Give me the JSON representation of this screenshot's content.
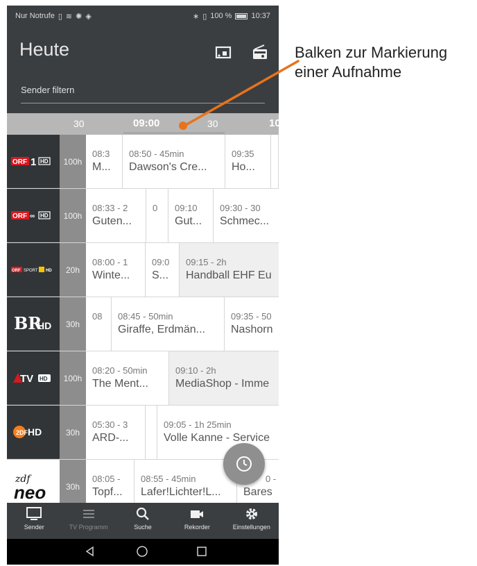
{
  "status_bar": {
    "left_text": "Nur Notrufe",
    "battery": "100 %",
    "time": "10:37"
  },
  "app_bar": {
    "title": "Heute",
    "icons": [
      "cast-icon",
      "radio-icon"
    ]
  },
  "filter": {
    "placeholder": "Sender filtern"
  },
  "timeline": {
    "labels": [
      "30",
      "09:00",
      "30",
      "10"
    ]
  },
  "channels": [
    {
      "logo": "ORF 1 HD",
      "duration": "100h",
      "programs": [
        {
          "time": "08:3",
          "title": "M..."
        },
        {
          "time": "08:50 - 45min",
          "title": "Dawson's Cre..."
        },
        {
          "time": "09:35",
          "title": "Ho..."
        },
        {
          "time": "·",
          "title": ""
        }
      ]
    },
    {
      "logo": "ORF III HD",
      "duration": "100h",
      "programs": [
        {
          "time": "08:33 - 2",
          "title": "Guten..."
        },
        {
          "time": "0",
          "title": ""
        },
        {
          "time": "09:10",
          "title": "Gut..."
        },
        {
          "time": "09:30 - 30",
          "title": "Schmec..."
        }
      ]
    },
    {
      "logo": "ORF SPORT+ HD",
      "duration": "20h",
      "programs": [
        {
          "time": "08:00 - 1",
          "title": "Winte..."
        },
        {
          "time": "09:0",
          "title": "S..."
        },
        {
          "time": "09:15 - 2h",
          "title": "Handball EHF Eu"
        }
      ]
    },
    {
      "logo": "BR HD",
      "duration": "30h",
      "programs": [
        {
          "time": "08",
          "title": ""
        },
        {
          "time": "08:45 - 50min",
          "title": "Giraffe, Erdmän..."
        },
        {
          "time": "09:35 - 50",
          "title": "Nashorn"
        }
      ]
    },
    {
      "logo": "ATV HD",
      "duration": "100h",
      "programs": [
        {
          "time": "08:20 - 50min",
          "title": "The Ment..."
        },
        {
          "time": "09:10 - 2h",
          "title": "MediaShop - Imme"
        }
      ]
    },
    {
      "logo": "ZDF HD",
      "duration": "30h",
      "programs": [
        {
          "time": "05:30 - 3",
          "title": "ARD-..."
        },
        {
          "time": "",
          "title": ""
        },
        {
          "time": "09:05 - 1h 25min",
          "title": "Volle Kanne - Service"
        }
      ]
    },
    {
      "logo": "zdf neo",
      "duration": "30h",
      "programs": [
        {
          "time": "08:05 -",
          "title": "Topf..."
        },
        {
          "time": "08:55 - 45min",
          "title": "Lafer!Lichter!L..."
        },
        {
          "time": "0 -",
          "title": "Bares"
        }
      ]
    }
  ],
  "bottom_nav": [
    {
      "label": "Sender",
      "icon": "tv-icon"
    },
    {
      "label": "TV Programm",
      "icon": "list-icon"
    },
    {
      "label": "Suche",
      "icon": "search-icon"
    },
    {
      "label": "Rekorder",
      "icon": "camera-icon"
    },
    {
      "label": "Einstellungen",
      "icon": "gear-icon"
    }
  ],
  "annotation": {
    "line1": "Balken zur Markierung",
    "line2": "einer Aufnahme",
    "color": "#e8731a"
  }
}
